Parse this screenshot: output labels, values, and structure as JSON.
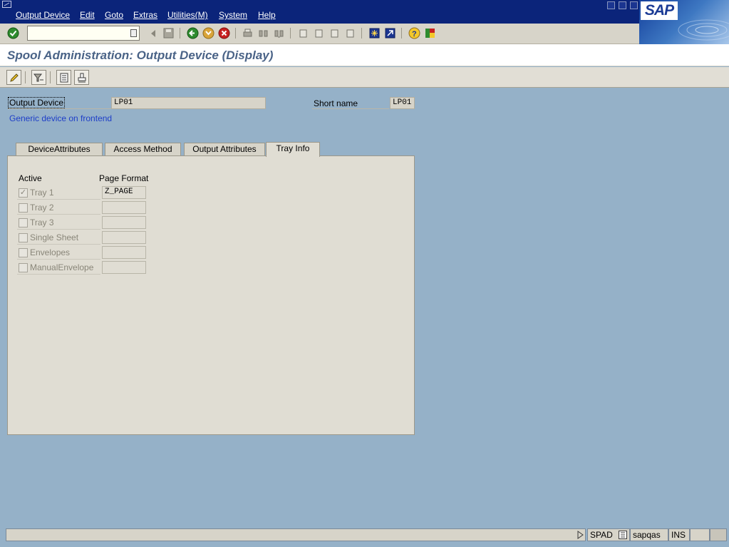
{
  "menu": {
    "items": [
      "Output Device",
      "Edit",
      "Goto",
      "Extras",
      "Utilities(M)",
      "System",
      "Help"
    ]
  },
  "logo": {
    "text": "SAP"
  },
  "command_field": {
    "value": ""
  },
  "title": "Spool Administration: Output Device (Display)",
  "header": {
    "output_device_label": "Output Device",
    "output_device_value": "LP01",
    "short_name_label": "Short name",
    "short_name_value": "LP01",
    "description": "Generic device on frontend"
  },
  "tabs": [
    {
      "label": "DeviceAttributes",
      "active": false
    },
    {
      "label": "Access Method",
      "active": false
    },
    {
      "label": "Output Attributes",
      "active": false
    },
    {
      "label": "Tray Info",
      "active": true
    }
  ],
  "tray_table": {
    "col_active": "Active",
    "col_page_format": "Page Format",
    "rows": [
      {
        "label": "Tray 1",
        "checked": true,
        "page_format": "Z_PAGE"
      },
      {
        "label": "Tray 2",
        "checked": false,
        "page_format": ""
      },
      {
        "label": "Tray 3",
        "checked": false,
        "page_format": ""
      },
      {
        "label": "Single Sheet",
        "checked": false,
        "page_format": ""
      },
      {
        "label": "Envelopes",
        "checked": false,
        "page_format": ""
      },
      {
        "label": "ManualEnvelope",
        "checked": false,
        "page_format": ""
      }
    ]
  },
  "status": {
    "transaction": "SPAD",
    "server": "sapqas",
    "mode": "INS"
  },
  "colors": {
    "menu_bg": "#0b247a",
    "background": "#95b1c8",
    "title_text": "#4a6387",
    "link_text": "#1e3ec8"
  }
}
